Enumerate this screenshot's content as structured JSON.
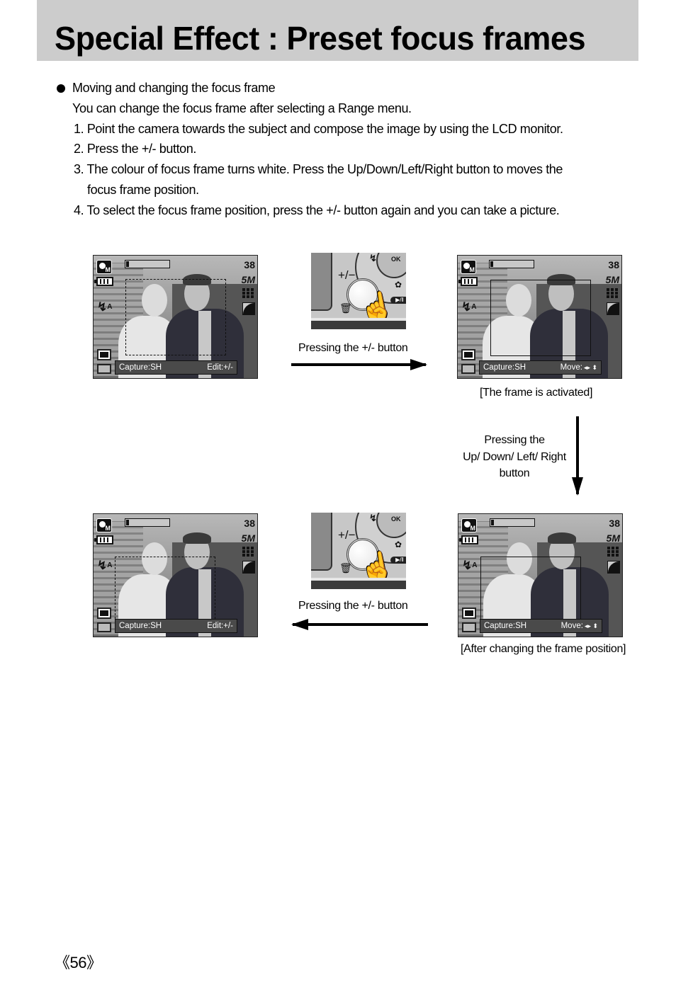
{
  "header": {
    "title": "Special Effect : Preset focus frames"
  },
  "instructions": {
    "heading": "Moving and changing the focus frame",
    "intro": "You can change the focus frame after selecting a Range menu.",
    "steps": [
      "1. Point the camera towards the subject and compose the image by using the LCD monitor.",
      "2. Press the +/- button.",
      "3. The colour of focus frame turns white. Press the Up/Down/Left/Right button to moves the",
      "4. To select the focus frame position, press the +/- button again and you can take a picture."
    ],
    "step3_continuation": "focus frame position."
  },
  "lcd_screens": [
    {
      "id": "initial",
      "shots_remaining": "38",
      "image_size": "5M",
      "mode_icon": "M",
      "capture_label": "Capture:SH",
      "action_label": "Edit:+/-",
      "frame_style": "dashed",
      "caption": ""
    },
    {
      "id": "activated",
      "shots_remaining": "38",
      "image_size": "5M",
      "mode_icon": "M",
      "capture_label": "Capture:SH",
      "action_label": "Move:",
      "action_arrows": "◂▸ ⬍",
      "frame_style": "solid",
      "caption": "[The frame is activated]"
    },
    {
      "id": "moved",
      "shots_remaining": "38",
      "image_size": "5M",
      "mode_icon": "M",
      "capture_label": "Capture:SH",
      "action_label": "Move:",
      "action_arrows": "◂▸ ⬍",
      "frame_style": "solid",
      "caption": "[After changing the frame position]"
    },
    {
      "id": "final",
      "shots_remaining": "38",
      "image_size": "5M",
      "mode_icon": "M",
      "capture_label": "Capture:SH",
      "action_label": "Edit:+/-",
      "frame_style": "dashed",
      "caption": ""
    }
  ],
  "button_photos": [
    {
      "plus_minus": "+/−",
      "ok_label": "OK",
      "play_label": "▶/‖",
      "caption": "Pressing the +/- button"
    },
    {
      "plus_minus": "+/−",
      "ok_label": "OK",
      "play_label": "▶/‖",
      "caption": "Pressing the +/- button"
    }
  ],
  "vertical_step": {
    "line1": "Pressing the",
    "line2": "Up/ Down/ Left/ Right",
    "line3": "button"
  },
  "footer": {
    "page_number": "《56》"
  }
}
